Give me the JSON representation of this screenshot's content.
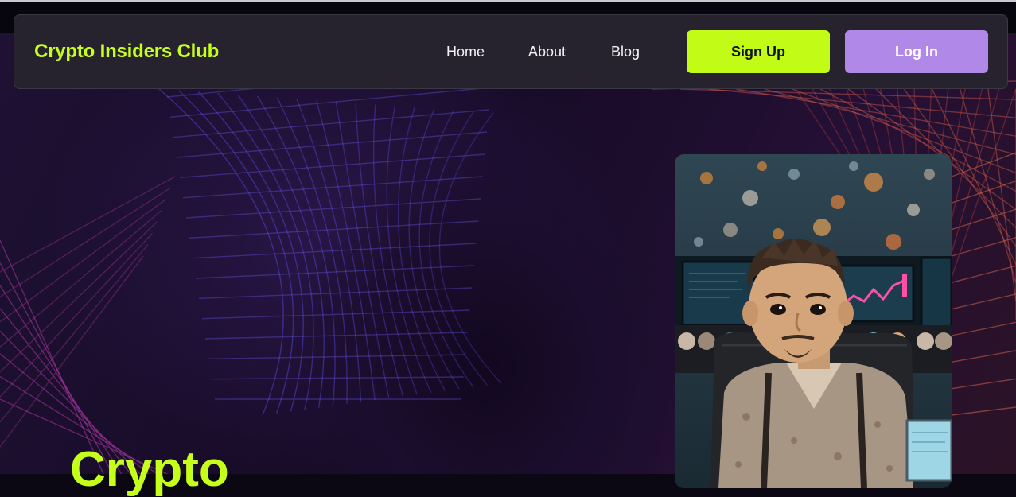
{
  "header": {
    "brand": "Crypto Insiders Club",
    "nav": [
      {
        "label": "Home"
      },
      {
        "label": "About"
      },
      {
        "label": "Blog"
      }
    ],
    "signup_label": "Sign Up",
    "login_label": "Log In"
  },
  "hero": {
    "title": "Crypto"
  },
  "colors": {
    "accent_lime": "#c2fb15",
    "accent_purple": "#b089e8",
    "navbar_bg": "#26232f",
    "page_bg": "#170b27"
  }
}
